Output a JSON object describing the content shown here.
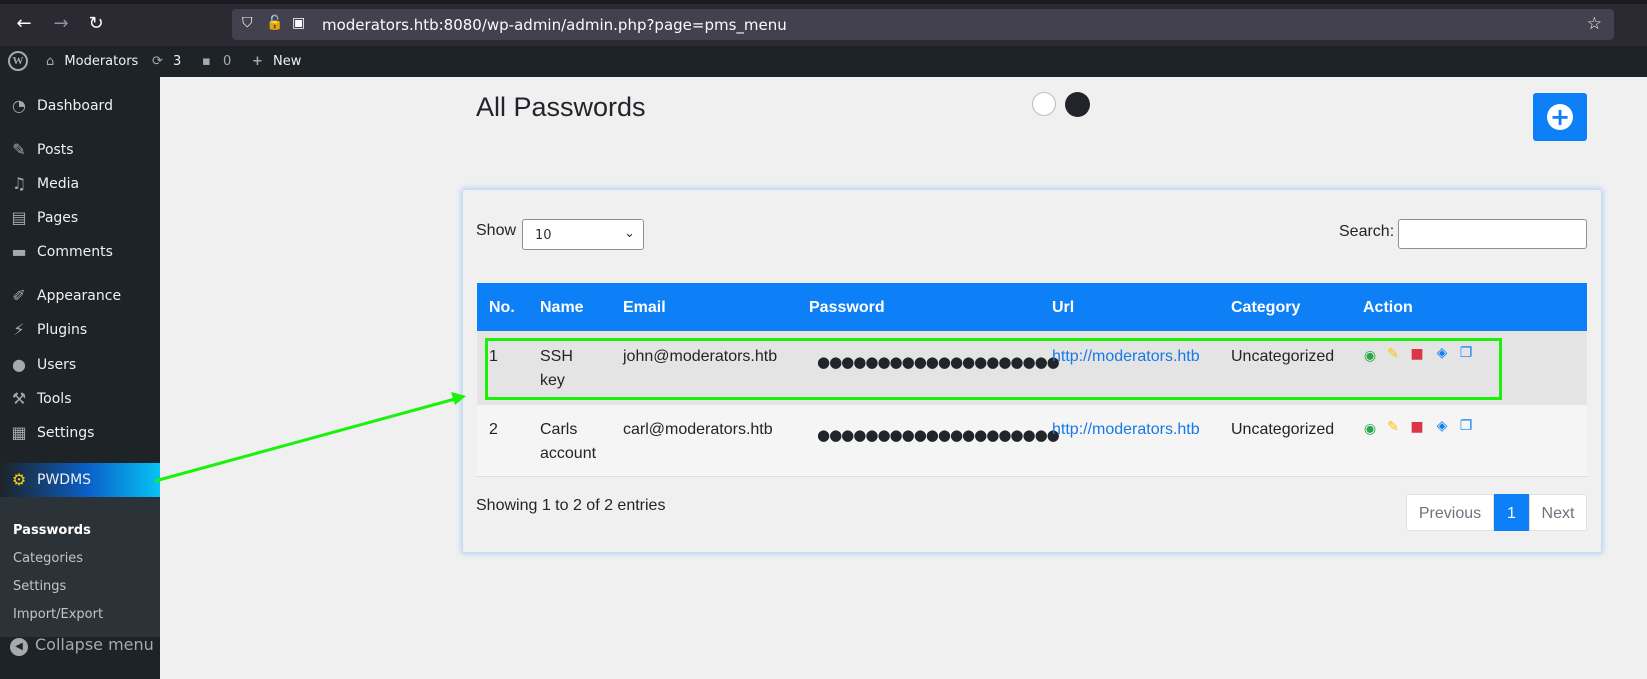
{
  "browser": {
    "back_icon": "←",
    "forward_icon": "→",
    "reload_icon": "↻",
    "url": "moderators.htb:8080/wp-admin/admin.php?page=pms_menu",
    "bookmark_icon": "☆"
  },
  "adminbar": {
    "site_name": "Moderators",
    "updates_count": "3",
    "comments_count": "0",
    "new_label": "New"
  },
  "sidebar": {
    "items": [
      {
        "label": "Dashboard",
        "icon": "dashboard-icon"
      },
      {
        "label": "Posts",
        "icon": "pin-icon"
      },
      {
        "label": "Media",
        "icon": "media-icon"
      },
      {
        "label": "Pages",
        "icon": "pages-icon"
      },
      {
        "label": "Comments",
        "icon": "comment-icon"
      },
      {
        "label": "Appearance",
        "icon": "brush-icon"
      },
      {
        "label": "Plugins",
        "icon": "plug-icon"
      },
      {
        "label": "Users",
        "icon": "user-icon"
      },
      {
        "label": "Tools",
        "icon": "wrench-icon"
      },
      {
        "label": "Settings",
        "icon": "sliders-icon"
      },
      {
        "label": "PWDMS",
        "icon": "gear-icon"
      }
    ],
    "submenu": [
      "Passwords",
      "Categories",
      "Settings",
      "Import/Export"
    ],
    "collapse_label": "Collapse menu"
  },
  "main": {
    "title": "All Passwords",
    "show_label": "Show",
    "page_length": "10",
    "search_label": "Search:",
    "columns": [
      "No.",
      "Name",
      "Email",
      "Password",
      "Url",
      "Category",
      "Action"
    ],
    "rows": [
      {
        "no": "1",
        "name_line1": "SSH",
        "name_line2": "key",
        "email": "john@moderators.htb",
        "password": "●●●●●●●●●●●●●●●●●●●●",
        "url": "http://moderators.htb",
        "category": "Uncategorized"
      },
      {
        "no": "2",
        "name_line1": "Carls",
        "name_line2": "account",
        "email": "carl@moderators.htb",
        "password": "●●●●●●●●●●●●●●●●●●●●",
        "url": "http://moderators.htb",
        "category": "Uncategorized"
      }
    ],
    "entries_info": "Showing 1 to 2 of 2 entries",
    "pagination": {
      "previous": "Previous",
      "current": "1",
      "next": "Next"
    }
  },
  "colors": {
    "accent": "#0d80f8",
    "highlight": "#1bf20b",
    "view": "#28a745",
    "edit": "#ffc107",
    "delete": "#dc3545"
  }
}
